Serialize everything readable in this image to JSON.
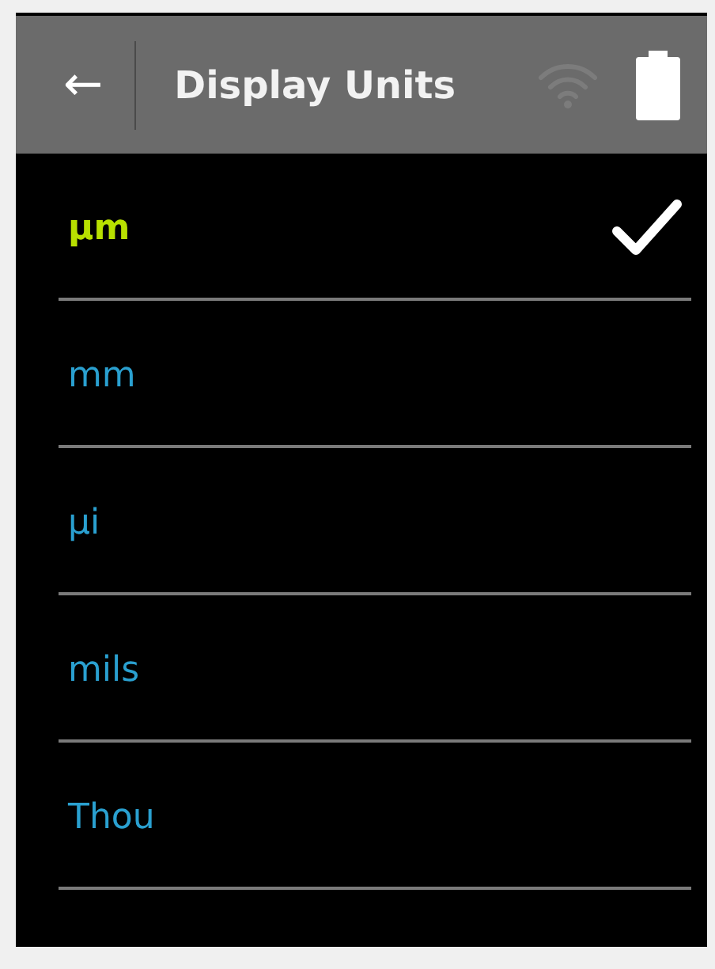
{
  "header": {
    "back_icon": "←",
    "title": "Display Units",
    "wifi_connected": false
  },
  "units": [
    {
      "label": "µm",
      "selected": true
    },
    {
      "label": "mm",
      "selected": false
    },
    {
      "label": "µi",
      "selected": false
    },
    {
      "label": "mils",
      "selected": false
    },
    {
      "label": "Thou",
      "selected": false
    }
  ]
}
